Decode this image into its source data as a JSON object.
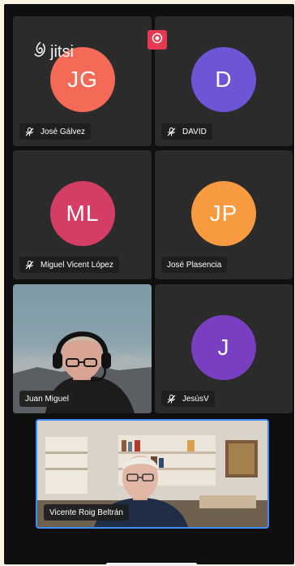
{
  "app": {
    "logo_text": "jitsi",
    "logo_icon": "jitsi-logo-icon",
    "record_icon": "record-icon",
    "accent_color": "#3f8ef7",
    "record_color": "#e8384f"
  },
  "participants": [
    {
      "initials": "JG",
      "name": "José Gálvez",
      "muted": true,
      "avatar_color": "#f46a56"
    },
    {
      "initials": "D",
      "name": "DAVID",
      "muted": true,
      "avatar_color": "#6d55d6"
    },
    {
      "initials": "ML",
      "name": "Miguel Vicent López",
      "muted": true,
      "avatar_color": "#d53e64"
    },
    {
      "initials": "JP",
      "name": "José Plasencia",
      "muted": false,
      "avatar_color": "#f79a40"
    },
    {
      "initials": "",
      "name": "Juan Miguel",
      "muted": false,
      "video": true
    },
    {
      "initials": "J",
      "name": "JesúsV",
      "muted": true,
      "avatar_color": "#7a3fc0"
    }
  ],
  "local_video": {
    "name": "Vicente Roig Beltrán",
    "highlighted": true
  }
}
